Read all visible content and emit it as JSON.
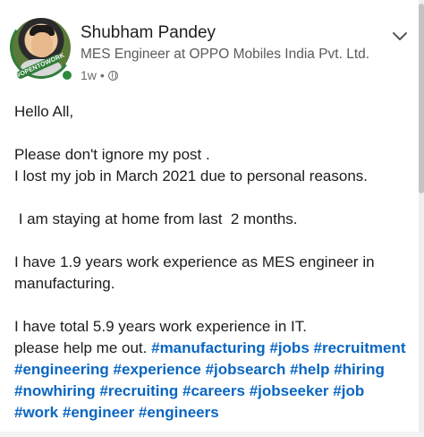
{
  "author": {
    "name": "Shubham Pandey",
    "headline": "MES Engineer at OPPO Mobiles India Pvt. Ltd.",
    "time_ago": "1w",
    "separator": "•",
    "visibility_icon": "globe-icon",
    "ring_label": "#OPENTOWORK"
  },
  "post": {
    "greeting": "Hello All,",
    "line1": "Please don't ignore my post .",
    "line2": "I lost my job in March 2021 due to personal reasons.",
    "line3": " I am staying at home from last  2 months.",
    "line4": "I have 1.9 years work experience as MES engineer in manufacturing.",
    "line5": "I have total 5.9 years work experience in IT.",
    "line6_prefix": "please help me out. ",
    "hashtags": [
      "#manufacturing",
      "#jobs",
      "#recruitment",
      "#engineering",
      "#experience",
      "#jobsearch",
      "#help",
      "#hiring",
      "#nowhiring",
      "#recruiting",
      "#careers",
      "#jobseeker",
      "#job",
      "#work",
      "#engineer",
      "#engineers"
    ]
  },
  "colors": {
    "hashtag": "#0a66c2",
    "open_to_work": "#2f7d3a"
  }
}
